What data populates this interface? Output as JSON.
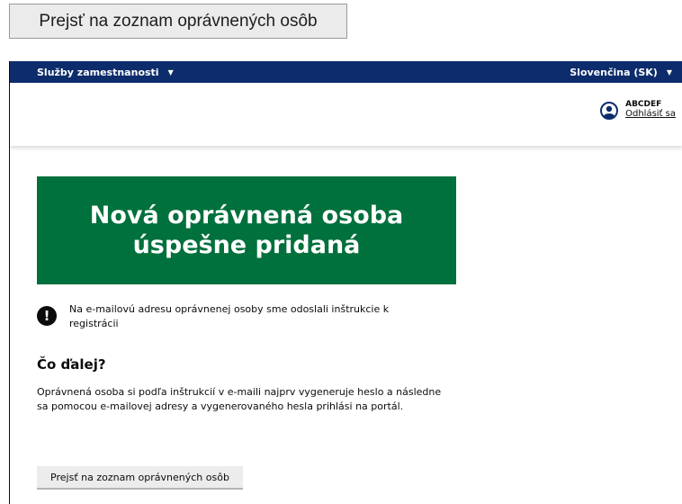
{
  "zoomed_button": {
    "label": "Prejsť na zoznam oprávnených osôb"
  },
  "topbar": {
    "menu_label": "Služby zamestnanosti",
    "language_label": "Slovenčina (SK)",
    "background": "#0d2c6b"
  },
  "header": {
    "user_name": "ABCDEF",
    "logout_label": "Odhlásiť sa"
  },
  "banner": {
    "line1": "Nová oprávnená osoba",
    "line2": "úspešne pridaná",
    "background": "#00703c"
  },
  "notice": {
    "icon": "!",
    "text": "Na e-mailovú adresu oprávnenej osoby sme odoslali inštrukcie k registrácii"
  },
  "next_steps": {
    "heading": "Čo ďalej?",
    "text": "Oprávnená osoba si podľa inštrukcií v e-maili najprv vygeneruje heslo a následne sa pomocou e-mailovej adresy a vygenerovaného hesla prihlási na portál."
  },
  "actions": {
    "list_button_label": "Prejsť na zoznam oprávnených osôb"
  },
  "icons": {
    "user": "user-circle-icon",
    "notice": "exclamation-icon",
    "dropdown": "caret-down-icon"
  }
}
